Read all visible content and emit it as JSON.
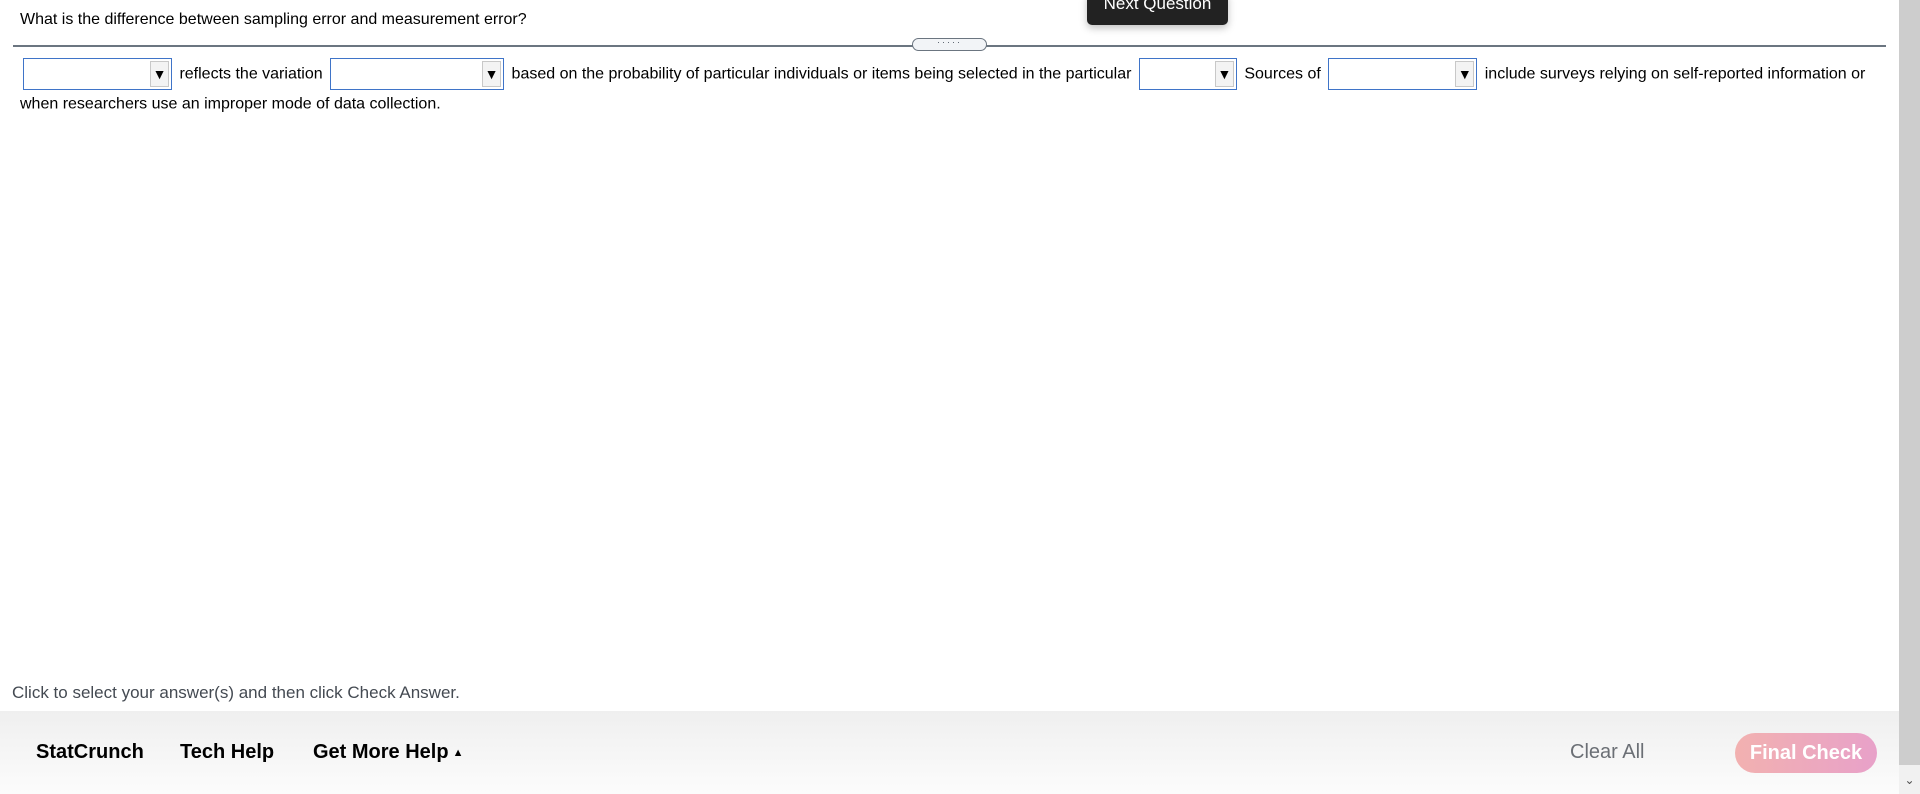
{
  "question": {
    "text": "What is the difference between sampling error and measurement error?"
  },
  "tooltip": {
    "label": "Next Question"
  },
  "divider": {
    "handle_glyph": "·····"
  },
  "answer": {
    "segments": [
      "reflects the variation",
      "based on the probability of particular individuals or items being selected in the particular",
      "Sources of",
      "include surveys relying on self-reported information or when researchers use an improper mode of data collection."
    ],
    "dropdowns": [
      {
        "selected": "",
        "arrow_icon": "▼"
      },
      {
        "selected": "",
        "arrow_icon": "▼"
      },
      {
        "selected": "",
        "arrow_icon": "▼"
      },
      {
        "selected": "",
        "arrow_icon": "▼"
      }
    ]
  },
  "instruction": "Click to select your answer(s) and then click Check Answer.",
  "footer": {
    "statcrunch": "StatCrunch",
    "tech_help": "Tech Help",
    "get_more_help": "Get More Help",
    "get_more_help_caret": "▲",
    "clear_all": "Clear All",
    "final_check": "Final Check"
  },
  "scrollbar": {
    "down_arrow": "⌄"
  },
  "colors": {
    "dropdown_border": "#3f74c8",
    "final_check_gradient_start": "#f2b1b0",
    "final_check_gradient_end": "#e8a1c9",
    "tooltip_bg": "#222222"
  }
}
